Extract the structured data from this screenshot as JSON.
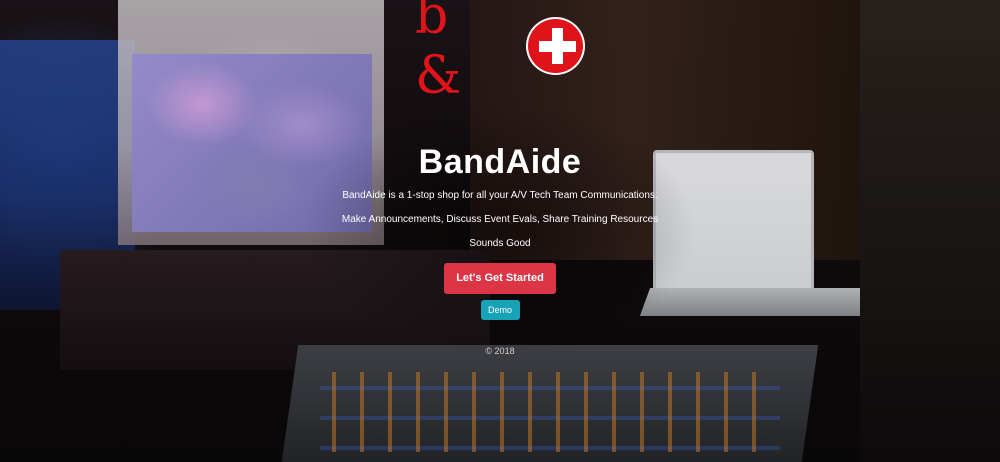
{
  "logo": {
    "text": "b &",
    "icon": "red-cross-icon",
    "color": "#e0131a"
  },
  "hero": {
    "title": "BandAide",
    "tagline": "BandAide is a 1-stop shop for all your A/V Tech Team Communications.",
    "features": "Make Announcements, Discuss Event Evals, Share Training Resources",
    "motto": "Sounds Good"
  },
  "buttons": {
    "get_started": "Let's Get Started",
    "get_started_color": "#dc3545",
    "demo": "Demo",
    "demo_color": "#17a2b8"
  },
  "footer": {
    "copyright": "© 2018"
  }
}
